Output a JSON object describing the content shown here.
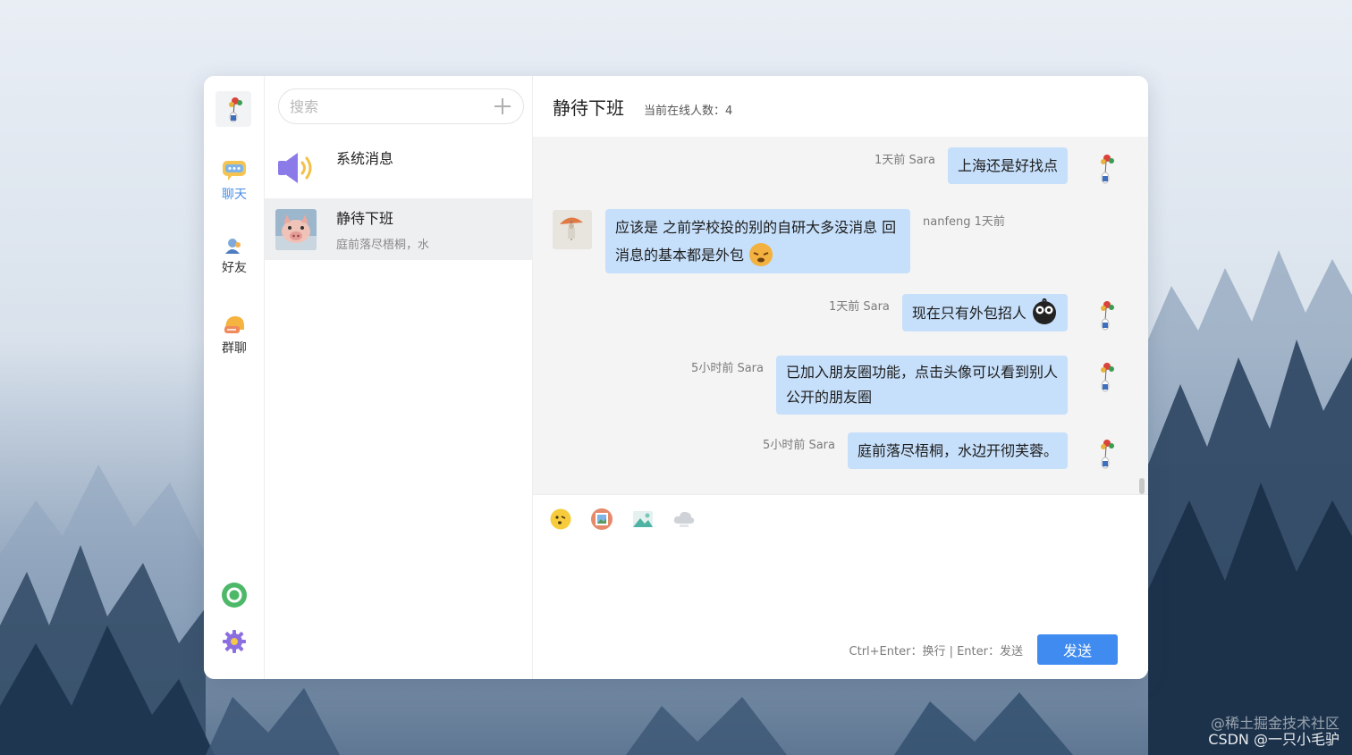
{
  "nav": {
    "items": [
      {
        "label": "聊天",
        "icon": "chat-bubble-icon",
        "active": true
      },
      {
        "label": "好友",
        "icon": "friends-icon",
        "active": false
      },
      {
        "label": "群聊",
        "icon": "group-chat-icon",
        "active": false
      }
    ],
    "bottom_icons": [
      "refresh-icon",
      "settings-gear-icon"
    ]
  },
  "search": {
    "placeholder": "搜索"
  },
  "conversations": [
    {
      "name": "系统消息",
      "preview": "",
      "icon": "speaker-icon"
    },
    {
      "name": "静待下班",
      "preview": "庭前落尽梧桐，水",
      "icon": "pig-avatar"
    }
  ],
  "chat": {
    "title": "静待下班",
    "online": "当前在线人数：4"
  },
  "messages": [
    {
      "side": "right",
      "meta": "1天前 Sara",
      "text": "上海还是好找点"
    },
    {
      "side": "left",
      "meta": "nanfeng 1天前",
      "text": "应该是 之前学校投的别的自研大多没消息 回",
      "text2": "消息的基本都是外包"
    },
    {
      "side": "right",
      "meta": "1天前 Sara",
      "text": "现在只有外包招人"
    },
    {
      "side": "right",
      "meta": "5小时前 Sara",
      "text": "已加入朋友圈功能，点击头像可以看到别人",
      "text2": "公开的朋友圈"
    },
    {
      "side": "right",
      "meta": "5小时前 Sara",
      "text": "庭前落尽梧桐，水边开彻芙蓉。"
    }
  ],
  "composer": {
    "tools": [
      "emoji-icon",
      "image-frame-icon",
      "picture-icon",
      "cloud-file-icon"
    ],
    "hint": "Ctrl+Enter：换行 | Enter：发送",
    "send_label": "发送"
  },
  "watermark": {
    "line1": "@稀土掘金技术社区",
    "line2": "CSDN @一只小毛驴"
  },
  "colors": {
    "accent": "#3f8bf0",
    "bubble": "#c6dffa",
    "active_nav": "#4a8fe8"
  }
}
